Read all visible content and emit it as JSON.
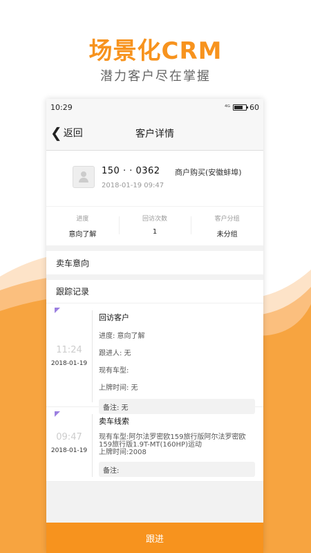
{
  "promo": {
    "title": "场景化CRM",
    "subtitle": "潜力客户尽在掌握"
  },
  "statusbar": {
    "time": "10:29",
    "signal": "⁴ᴳ",
    "battery": "60"
  },
  "navbar": {
    "back_label": "返回",
    "title": "客户详情"
  },
  "customer": {
    "phone": "150 ·  · 0362",
    "purchase_type": "商户购买(安徽蚌埠)",
    "date": "2018-01-19 09:47"
  },
  "stats": [
    {
      "label": "进度",
      "value": "意向了解"
    },
    {
      "label": "回访次数",
      "value": "1"
    },
    {
      "label": "客户分组",
      "value": "未分组"
    }
  ],
  "intent_section": {
    "title": "卖车意向"
  },
  "tracking": {
    "title": "跟踪记录",
    "records": [
      {
        "time": "11:24",
        "date": "2018-01-19",
        "title": "回访客户",
        "lines": [
          "进度: 意向了解",
          "跟进人: 无",
          "现有车型:",
          "上牌时间: 无"
        ],
        "remark": "备注: 无"
      },
      {
        "time": "09:47",
        "date": "2018-01-19",
        "title": "卖车线索",
        "lines": [
          "现有车型:阿尔法罗密欧159旅行版阿尔法罗密欧159旅行版1.9T-MT(160HP)运动",
          "上牌时间:2008"
        ],
        "remark": "备注:"
      }
    ]
  },
  "footer": {
    "follow_label": "跟进"
  },
  "colors": {
    "accent": "#f7931e",
    "flag": "#9b7fe0"
  }
}
